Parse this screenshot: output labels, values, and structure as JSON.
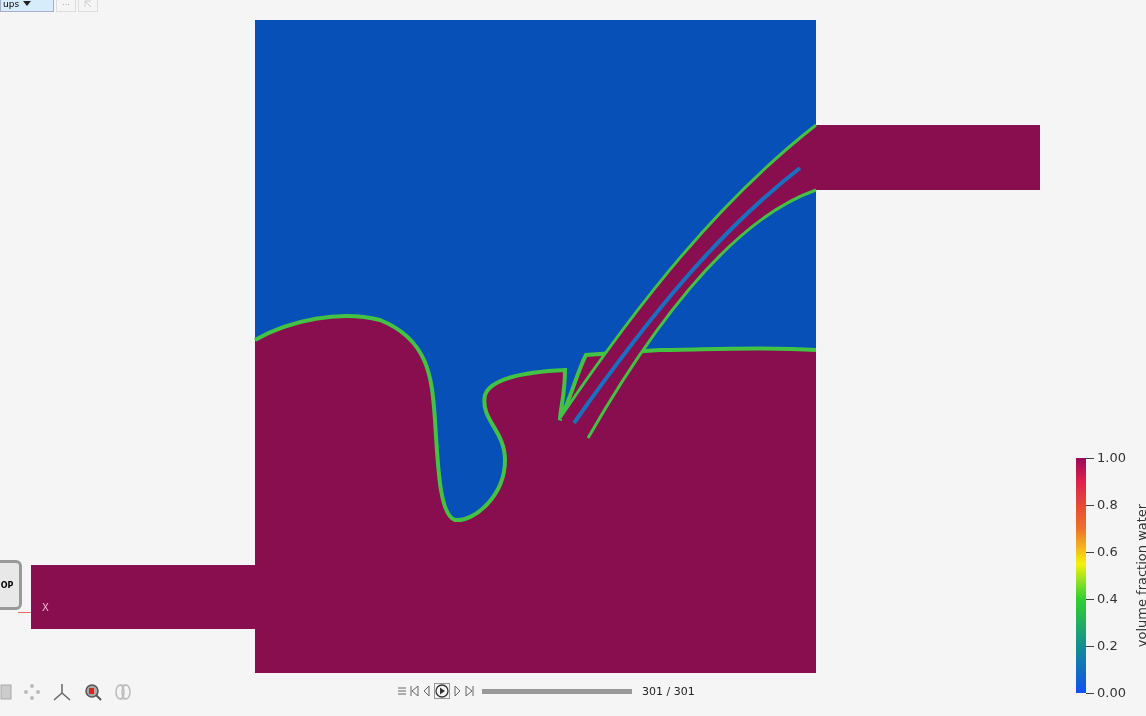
{
  "toolbar": {
    "dropdown": "ups",
    "more_button": "···"
  },
  "orientation": {
    "cube_label": "OP",
    "axis_label": "X"
  },
  "animation": {
    "level": 1,
    "frame": "301 / 301"
  },
  "colorbar": {
    "title": "volume fraction water",
    "ticks": [
      "1.00",
      "0.8",
      "0.6",
      "0.4",
      "0.2",
      "0.00"
    ]
  }
}
